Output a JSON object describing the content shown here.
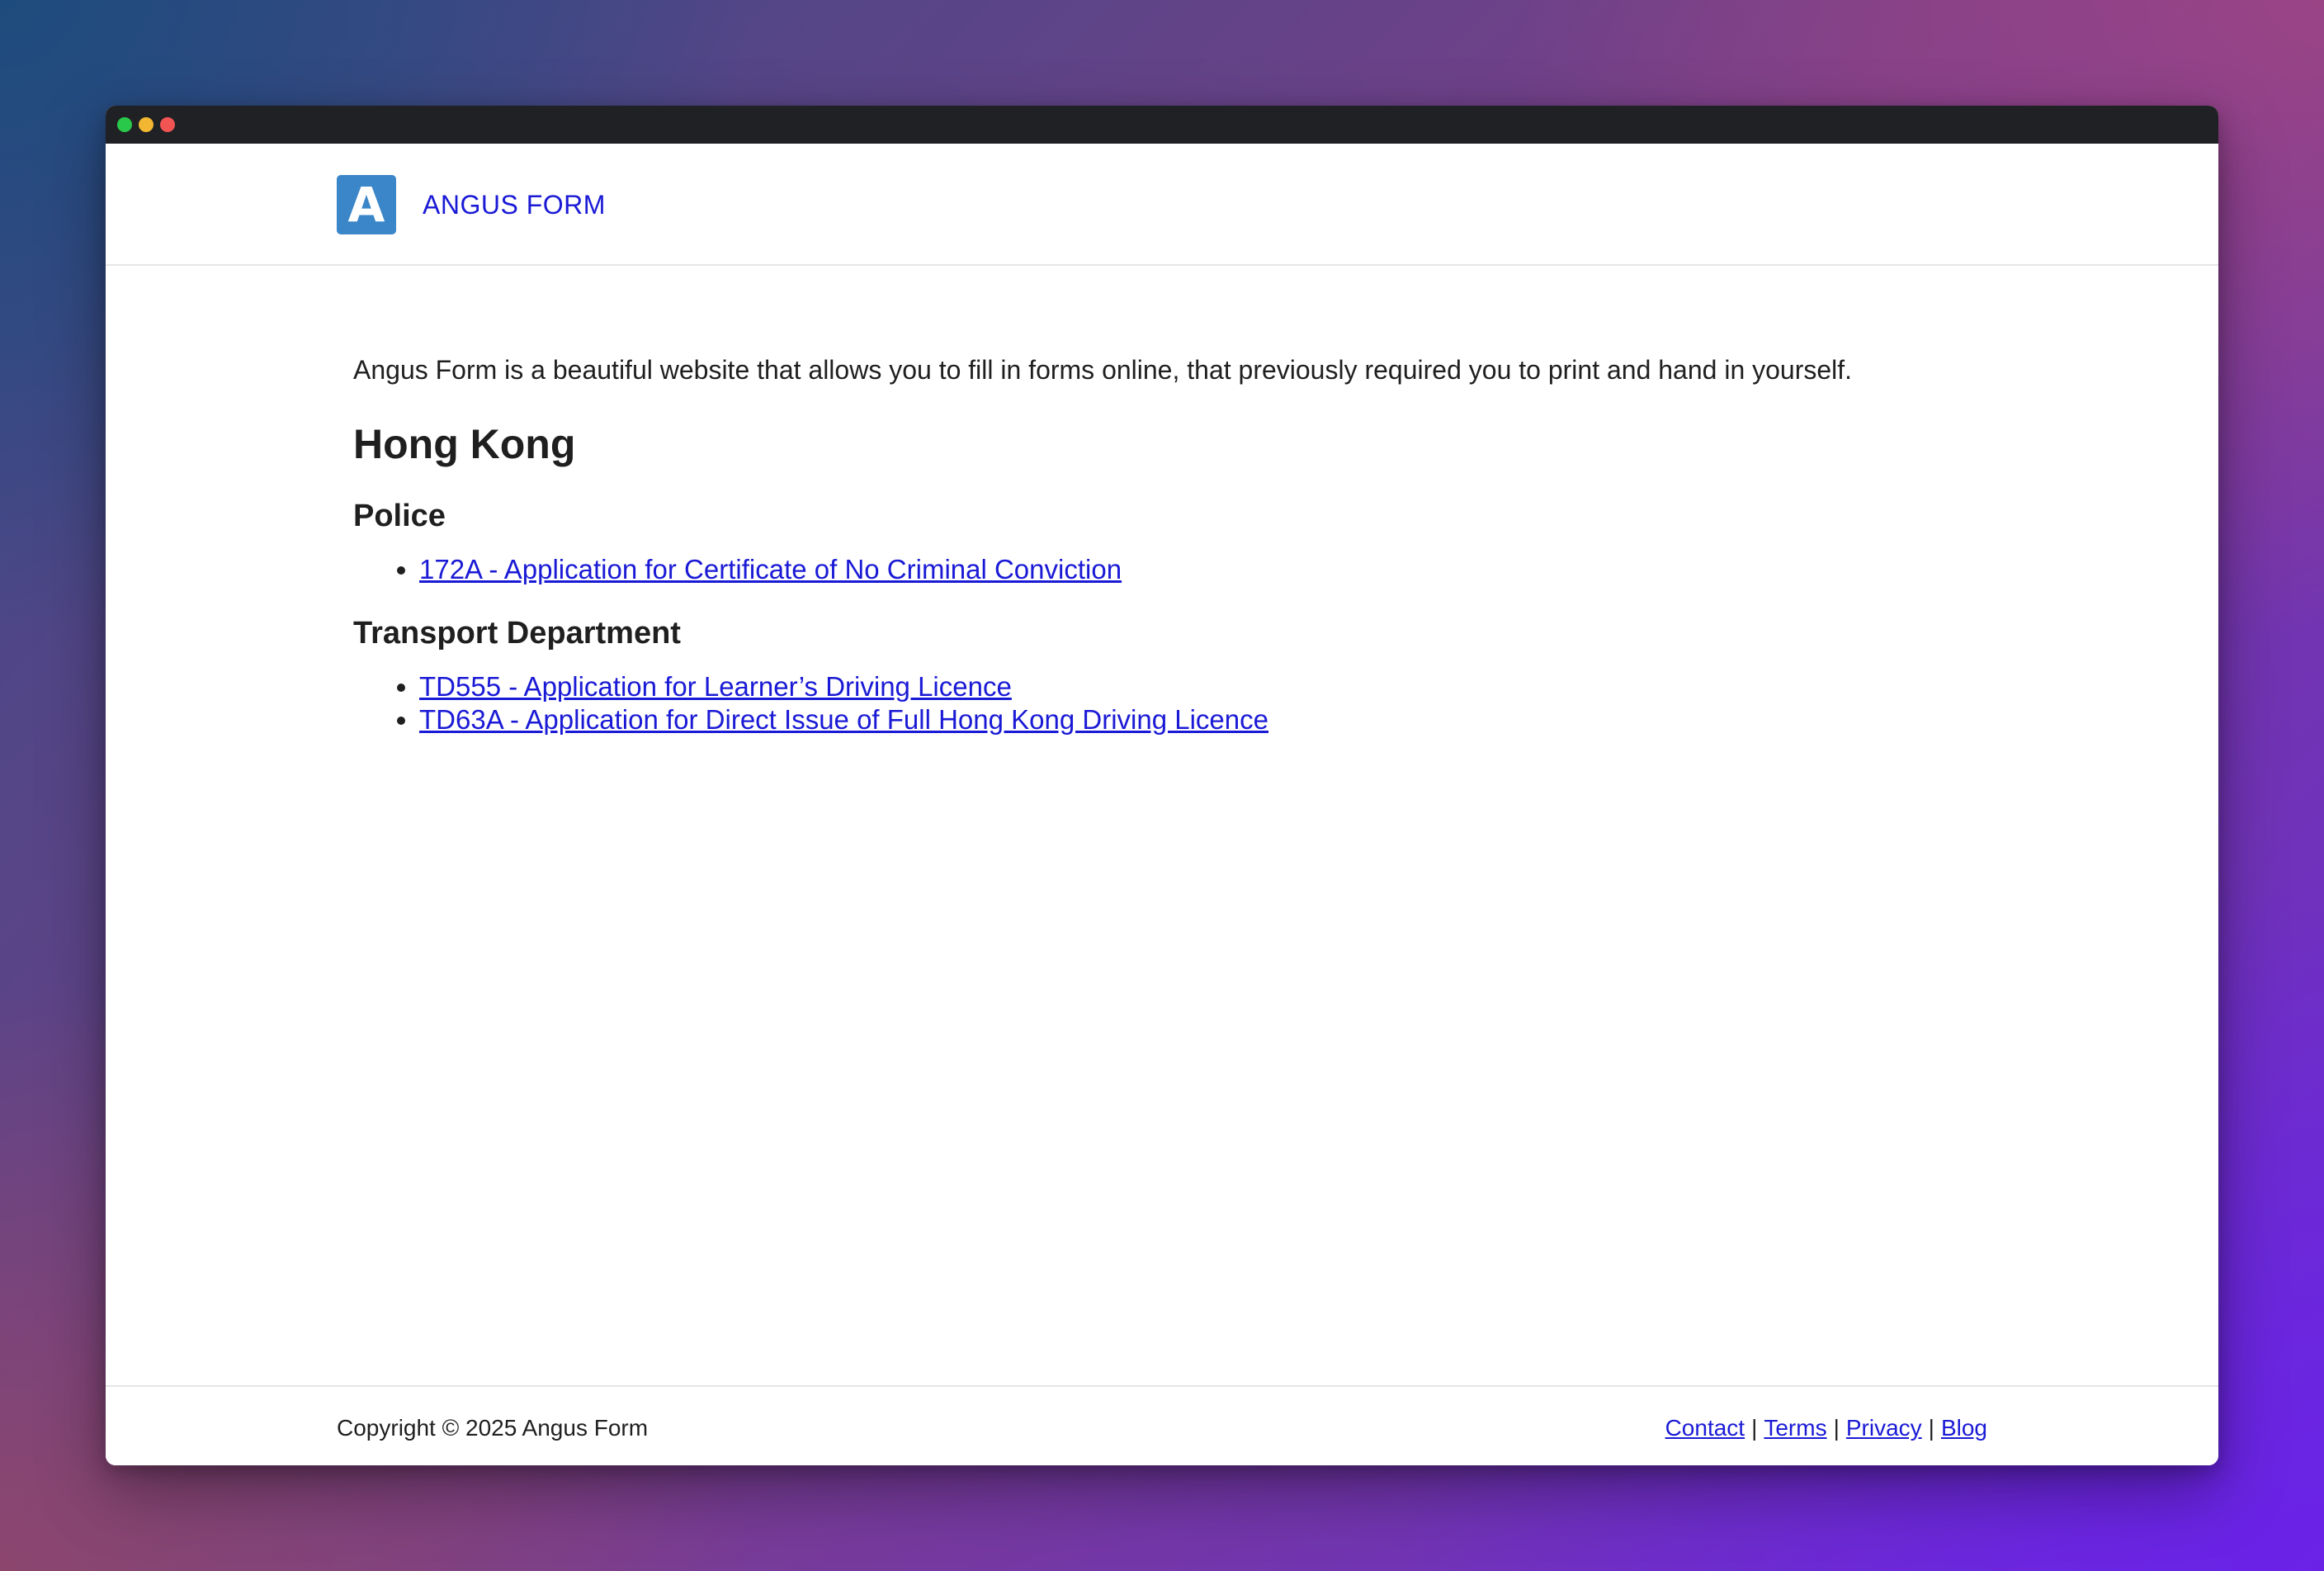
{
  "window": {
    "controls": [
      "close-dot",
      "minimize-dot",
      "zoom-dot"
    ]
  },
  "header": {
    "logo_letter": "A",
    "brand_label": "ANGUS FORM"
  },
  "main": {
    "intro": "Angus Form is a beautiful website that allows you to fill in forms online, that previously required you to print and hand in yourself.",
    "region_title": "Hong Kong",
    "departments": [
      {
        "name": "Police",
        "forms": [
          "172A - Application for Certificate of No Criminal Conviction"
        ]
      },
      {
        "name": "Transport Department",
        "forms": [
          "TD555 - Application for Learner’s Driving Licence",
          "TD63A - Application for Direct Issue of Full Hong Kong Driving Licence"
        ]
      }
    ]
  },
  "footer": {
    "copyright": "Copyright © 2025 Angus Form",
    "links": [
      "Contact",
      "Terms",
      "Privacy",
      "Blog"
    ],
    "separator": "|"
  },
  "colors": {
    "link": "#1a1ad6",
    "logo_bg": "#3a86c8",
    "titlebar": "#202124"
  }
}
